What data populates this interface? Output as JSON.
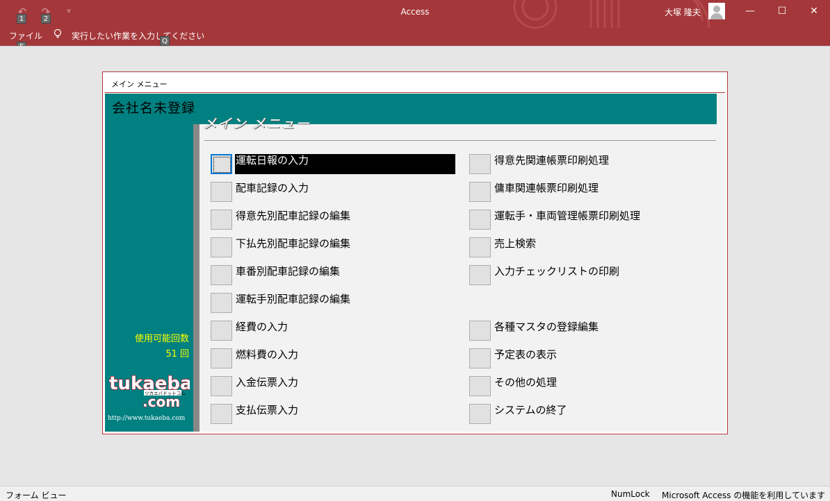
{
  "titlebar": {
    "app_title": "Access",
    "user_name": "大塚 隆夫",
    "undo_keytip": "1",
    "redo_keytip": "2",
    "customize_icon": "chevron-down-icon",
    "minimize": "—",
    "maximize": "☐",
    "close": "✕",
    "accent_color": "#a4373a"
  },
  "ribbon": {
    "file_tab": "ファイル",
    "file_keytip": "F",
    "tell_me": "実行したい作業を入力してください",
    "tell_me_keytip": "Q"
  },
  "form": {
    "caption": "メイン メニュー",
    "company_name": "会社名未登録",
    "menu_title": "メイン メニュー",
    "usage_label": "使用可能回数",
    "usage_count": "51 回",
    "logo_text_1": "tukaeba",
    "logo_kana": "ツカエバドットコム",
    "logo_text_2": ".com",
    "logo_url": "http://www.tukaeba.com",
    "band_color": "#008080",
    "left_options": [
      "運転日報の入力",
      "配車記録の入力",
      "得意先別配車記録の編集",
      "下払先別配車記録の編集",
      "車番別配車記録の編集",
      "運転手別配車記録の編集",
      "経費の入力",
      "燃料費の入力",
      "入金伝票入力",
      "支払伝票入力"
    ],
    "right_options": [
      "得意先関連帳票印刷処理",
      "傭車関連帳票印刷処理",
      "運転手・車両管理帳票印刷処理",
      "売上検索",
      "入力チェックリストの印刷",
      "各種マスタの登録編集",
      "予定表の表示",
      "その他の処理",
      "システムの終了"
    ]
  },
  "statusbar": {
    "view": "フォーム ビュー",
    "numlock": "NumLock",
    "message": "Microsoft Access の機能を利用しています"
  }
}
